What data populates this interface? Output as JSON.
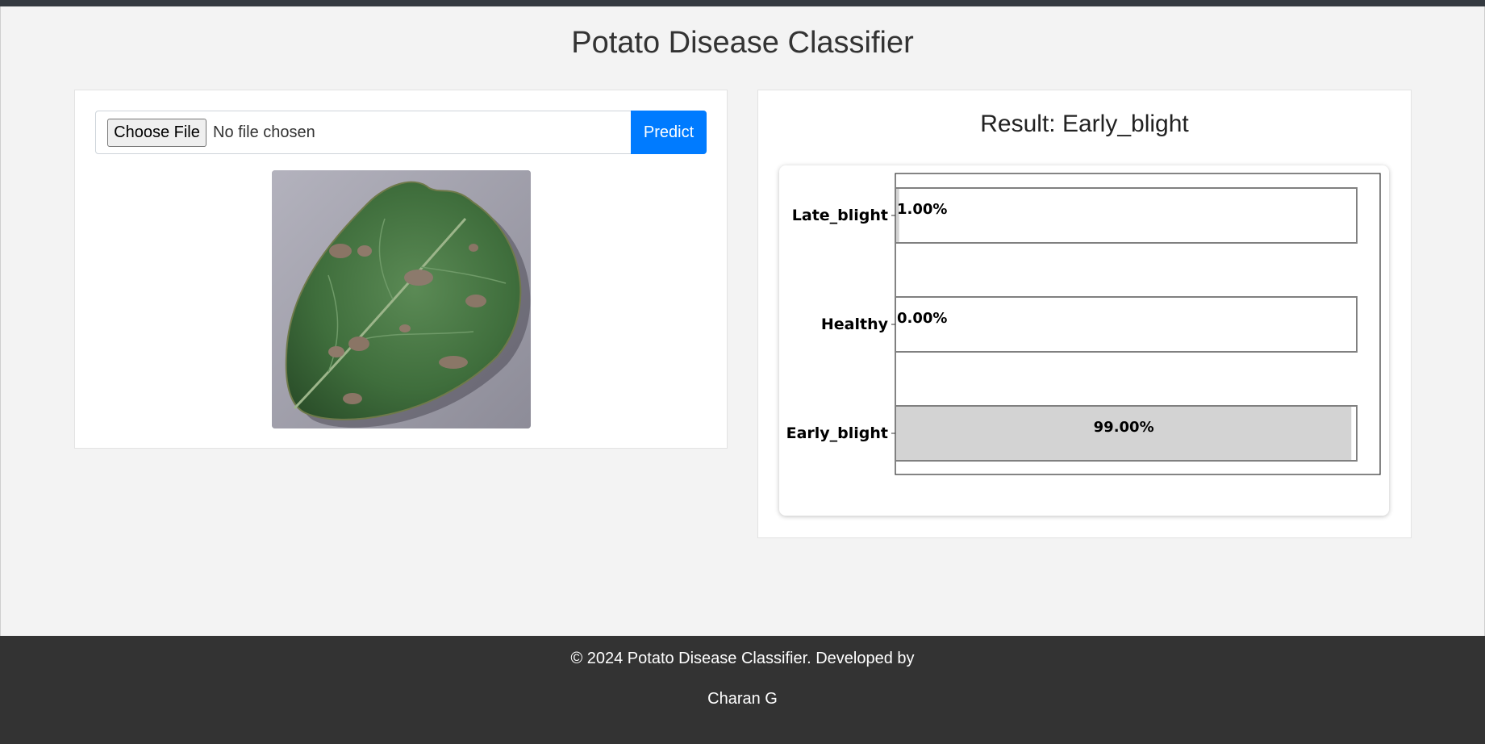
{
  "header": {
    "title": "Potato Disease Classifier"
  },
  "upload": {
    "choose_label": "Choose File",
    "file_status": "No file chosen",
    "predict_label": "Predict"
  },
  "result": {
    "title": "Result: Early_blight"
  },
  "colors": {
    "accent": "#007bff",
    "footer_bg": "#333333",
    "bar_fill": "#d3d3d3",
    "bar_edge": "#808080"
  },
  "chart_data": {
    "type": "bar",
    "orientation": "horizontal",
    "categories": [
      "Late_blight",
      "Healthy",
      "Early_blight"
    ],
    "values": [
      1.0,
      0.0,
      99.0
    ],
    "value_labels": [
      "1.00%",
      "0.00%",
      "99.00%"
    ],
    "xlim": [
      0,
      100
    ],
    "title": "",
    "xlabel": "",
    "ylabel": "",
    "grid": false
  },
  "footer": {
    "line1": "© 2024 Potato Disease Classifier. Developed by",
    "line2": "Charan G"
  }
}
